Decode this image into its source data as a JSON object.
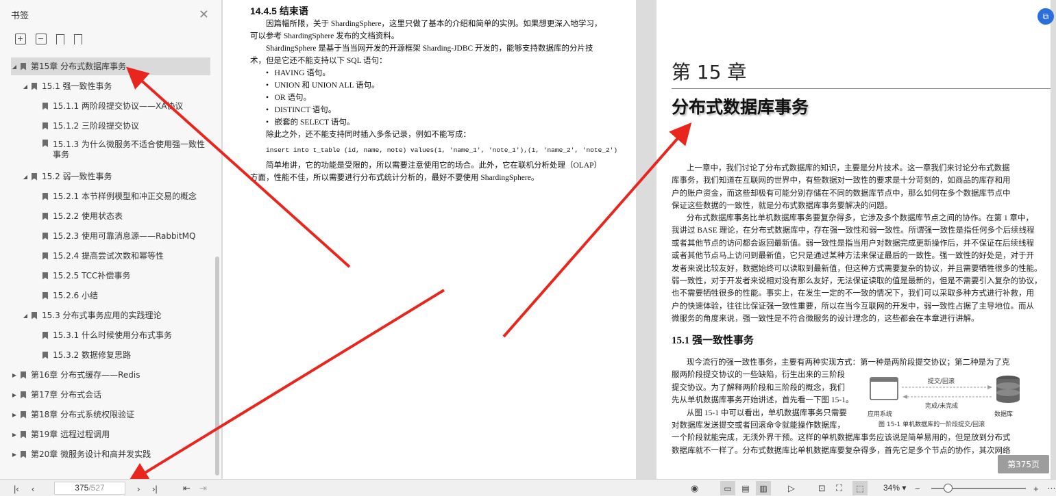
{
  "sidebar": {
    "title": "书签",
    "items": [
      {
        "label": "第15章 分布式数据库事务",
        "expanded": true,
        "selected": true
      },
      {
        "label": "15.1 强一致性事务",
        "expanded": true
      },
      {
        "label": "15.1.1 两阶段提交协议——XA协议"
      },
      {
        "label": "15.1.2 三阶段提交协议"
      },
      {
        "label": "15.1.3 为什么微服务不适合使用强一致性",
        "label2": "事务"
      },
      {
        "label": "15.2 弱一致性事务",
        "expanded": true
      },
      {
        "label": "15.2.1 本节样例模型和冲正交易的概念"
      },
      {
        "label": "15.2.2 使用状态表"
      },
      {
        "label": "15.2.3 使用可靠消息源——RabbitMQ"
      },
      {
        "label": "15.2.4 提高尝试次数和幂等性"
      },
      {
        "label": "15.2.5 TCC补偿事务"
      },
      {
        "label": "15.2.6 小结"
      },
      {
        "label": "15.3 分布式事务应用的实践理论",
        "expanded": true
      },
      {
        "label": "15.3.1 什么时候使用分布式事务"
      },
      {
        "label": "15.3.2 数据修复思路"
      },
      {
        "label": "第16章 分布式缓存——Redis",
        "expanded": false
      },
      {
        "label": "第17章 分布式会话",
        "expanded": false
      },
      {
        "label": "第18章 分布式系统权限验证",
        "expanded": false
      },
      {
        "label": "第19章 远程过程调用",
        "expanded": false
      },
      {
        "label": "第20章 微服务设计和高并发实践",
        "expanded": false
      }
    ]
  },
  "page_left": {
    "heading": "14.4.5   结束语",
    "p1a": "因篇幅所限，关于 ShardingSphere，这里只做了基本的介绍和简单的实例。如果想更深入地学习，",
    "p1b": "可以参考 ShardingSphere 发布的文档资料。",
    "p2a": "ShardingSphere 是基于当当网开发的开源框架 Sharding-JDBC 开发的，能够支持数据库的分片技",
    "p2b": "术，但是它还不能支持以下 SQL 语句：",
    "bullets": [
      "HAVING 语句。",
      "UNION 和 UNION ALL 语句。",
      "OR 语句。",
      "DISTINCT 语句。",
      "嵌套的 SELECT 语句。"
    ],
    "p3": "除此之外，还不能支持同时插入多条记录，例如不能写成：",
    "code": "insert into t_table (id, name, note) values(1, 'name_1', 'note_1'),(1, 'name_2', 'note_2')",
    "p4a": "简单地讲，它的功能是受限的，所以需要注意使用它的场合。此外，它在联机分析处理（OLAP）",
    "p4b": "方面，性能不佳，所以需要进行分布式统计分析的，最好不要使用 ShardingSphere。"
  },
  "page_right": {
    "chapter_no": "第 15 章",
    "chapter_title": "分布式数据库事务",
    "para1": [
      "上一章中，我们讨论了分布式数据库的知识，主要是分片技术。这一章我们来讨论分布式数据",
      "库事务，我们知道在互联网的世界中，有些数据对一致性的要求是十分苛刻的，如商品的库存和用",
      "户的账户资金，而这些却极有可能分别存储在不同的数据库节点中，那么如何在多个数据库节点中",
      "保证这些数据的一致性，就是分布式数据库事务要解决的问题。"
    ],
    "para2": [
      "分布式数据库事务比单机数据库事务要复杂得多，它涉及多个数据库节点之间的协作。在第 1 章中，",
      "我讲过 BASE 理论，在分布式数据库中，存在强一致性和弱一致性。所谓强一致性是指任何多个后续线程",
      "或者其他节点的访问都会返回最新值。弱一致性是指当用户对数据完成更新操作后，并不保证在后续线程",
      "或者其他节点马上访问到最新值，它只是通过某种方法来保证最后的一致性。强一致性的好处是，对于开",
      "发者来说比较友好，数据始终可以读取到最新值，但这种方式需要复杂的协议，并且需要牺牲很多的性能。",
      "弱一致性，对于开发者来说相对没有那么友好，无法保证读取的值是最新的，但是不需要引入复杂的协议，",
      "也不需要牺牲很多的性能。事实上，在发生一定的不一致的情况下，我们可以采取多种方式进行补救，用",
      "户的快速体验，往往比保证强一致性重要，所以在当今互联网的开发中，弱一致性占据了主导地位。而从",
      "微服务的角度来说，强一致性是不符合微服务的设计理念的，这些都会在本章进行讲解。"
    ],
    "section": "15.1   强一致性事务",
    "para3": [
      "现今流行的强一致性事务，主要有两种实现方式：第一种是两阶段提交协议；第二种是为了克",
      "服两阶段提交协议的一些缺陷，衍生出来的三阶段",
      "提交协议。为了解释两阶段和三阶段的概念，我们",
      "先从单机数据库事务开始讲述，首先看一下图 15-1。",
      "从图 15-1 中可以看出，单机数据库事务只需要",
      "对数据库发送提交或者回滚命令就能操作数据库，",
      "一个阶段就能完成，无须外界干预。这样的单机数据库事务应该说是简单易用的，但是放到分布式",
      "数据库就不一样了。分布式数据库比单机数据库要复杂得多，首先它是多个节点的协作，其次网络"
    ],
    "figure": {
      "top_label": "提交/回滚",
      "bottom_label": "完成/未完成",
      "left_caption": "应用系统",
      "right_caption": "数据库",
      "caption": "图 15-1   单机数据库的一阶段提交/回滚"
    },
    "page_badge": "第375页"
  },
  "toolbar": {
    "current_page": "375",
    "total_pages": "/527",
    "zoom": "34%"
  },
  "colors": {
    "arrow": "#e8261e",
    "sidebar_bg": "#f7f7f7",
    "selected_row": "#dadada",
    "accent": "#2a6fdb"
  }
}
